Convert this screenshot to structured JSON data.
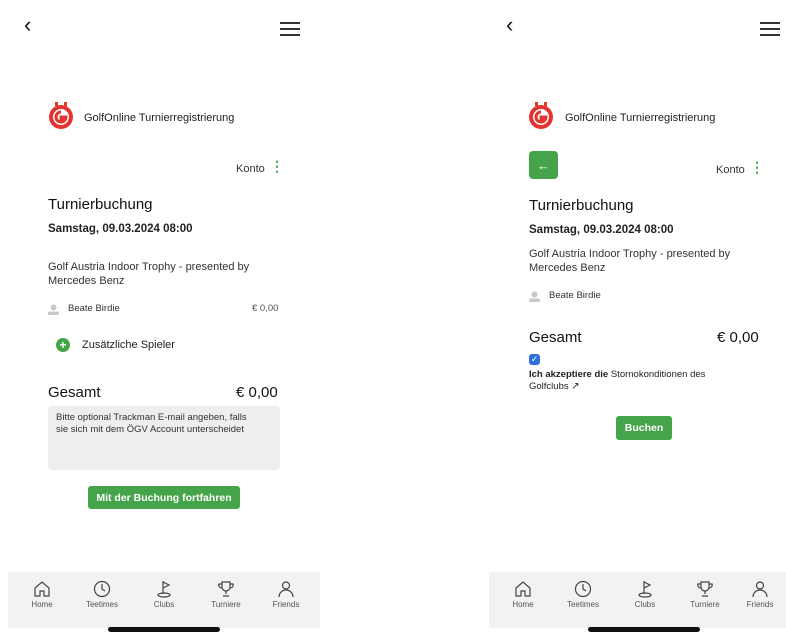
{
  "left": {
    "brand": "GolfOnline Turnierregistrierung",
    "konto": "Konto",
    "title": "Turnierbuchung",
    "date": "Samstag, 09.03.2024 08:00",
    "event_line1": "Golf Austria Indoor Trophy - presented by",
    "event_line2": "Mercedes Benz",
    "player": "Beate Birdie",
    "player_price": "€ 0,00",
    "add_players": "Zusätzliche Spieler",
    "total_label": "Gesamt",
    "total_value": "€ 0,00",
    "trackman_line1": "Bitte optional Trackman E-mail angeben, falls",
    "trackman_line2": "sie sich mit dem ÖGV Account unterscheidet",
    "continue_button": "Mit der Buchung fortfahren"
  },
  "right": {
    "brand": "GolfOnline Turnierregistrierung",
    "konto": "Konto",
    "title": "Turnierbuchung",
    "date": "Samstag, 09.03.2024 08:00",
    "event_line1": "Golf Austria Indoor Trophy - presented by",
    "event_line2": "Mercedes Benz",
    "player": "Beate Birdie",
    "total_label": "Gesamt",
    "total_value": "€ 0,00",
    "terms_prefix": "Ich akzeptiere die",
    "terms_link": "Stornokonditionen des",
    "terms_line2": "Golfclubs",
    "terms_checked": true,
    "book_button": "Buchen"
  },
  "tabbar": {
    "home": "Home",
    "teetimes": "Teetimes",
    "clubs": "Clubs",
    "turniere": "Turniere",
    "friends": "Friends"
  },
  "colors": {
    "accent_green": "#45a449",
    "brand_red": "#e3342f",
    "checkbox_blue": "#2f6fe0"
  }
}
